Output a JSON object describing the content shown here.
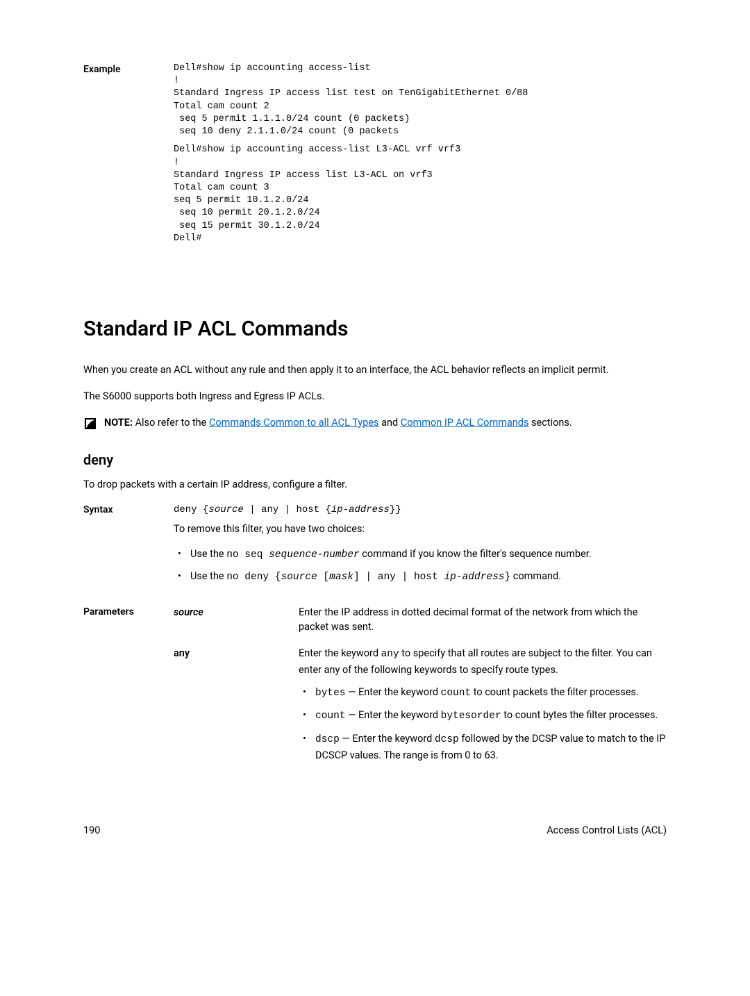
{
  "example": {
    "label": "Example",
    "block1": "Dell#show ip accounting access-list\n!\nStandard Ingress IP access list test on TenGigabitEthernet 0/88\nTotal cam count 2\n seq 5 permit 1.1.1.0/24 count (0 packets)\n seq 10 deny 2.1.1.0/24 count (0 packets",
    "block2": "Dell#show ip accounting access-list L3-ACL vrf vrf3\n!\nStandard Ingress IP access list L3-ACL on vrf3\nTotal cam count 3\nseq 5 permit 10.1.2.0/24\n seq 10 permit 20.1.2.0/24\n seq 15 permit 30.1.2.0/24\nDell#"
  },
  "h1": "Standard IP ACL Commands",
  "p1": "When you create an ACL without any rule and then apply it to an interface, the ACL behavior reflects an implicit permit.",
  "p2": "The S6000 supports both Ingress and Egress IP ACLs.",
  "note": {
    "label": "NOTE:",
    "prefix": " Also refer to the ",
    "link1": "Commands Common to all ACL Types",
    "mid": " and ",
    "link2": "Common IP ACL Commands",
    "suffix": " sections."
  },
  "h2": "deny",
  "p3": "To drop packets with a certain IP address, configure a filter.",
  "syntax": {
    "label": "Syntax",
    "code": {
      "pre": "deny {",
      "i1": "source",
      "mid1": " | any | host {",
      "i2": "ip-address",
      "post": "}}"
    },
    "sub": "To remove this filter, you have two choices:",
    "b1": {
      "t1": "Use the ",
      "c1": "no seq ",
      "i1": "sequence-number",
      "t2": " command if you know the filter's sequence number."
    },
    "b2": {
      "t1": "Use the ",
      "c1": "no deny {",
      "i1": "source",
      "c2": " [",
      "i2": "mask",
      "c3": "] | any | host ",
      "i3": "ip-address",
      "c4": "}",
      "t2": " command."
    }
  },
  "params": {
    "label": "Parameters",
    "source": {
      "name": "source",
      "desc": "Enter the IP address in dotted decimal format of the network from which the packet was sent."
    },
    "any": {
      "name": "any",
      "desc": {
        "t1": "Enter the keyword ",
        "c1": "any",
        "t2": " to specify that all routes are subject to the filter. You can enter any of the following keywords to specify route types."
      },
      "items": {
        "bytes": {
          "c1": "bytes",
          "t1": " — Enter the keyword ",
          "c2": "count",
          "t2": " to count packets the filter processes."
        },
        "count": {
          "c1": "count",
          "t1": " — Enter the keyword ",
          "c2": "bytesorder",
          "t2": " to count bytes the filter processes."
        },
        "dscp": {
          "c1": "dscp",
          "t1": " — Enter the keyword ",
          "c2": "dcsp",
          "t2": " followed by the DCSP value to match to the IP DCSCP values. The range is from 0 to 63."
        }
      }
    }
  },
  "footer": {
    "page": "190",
    "title": "Access Control Lists (ACL)"
  }
}
